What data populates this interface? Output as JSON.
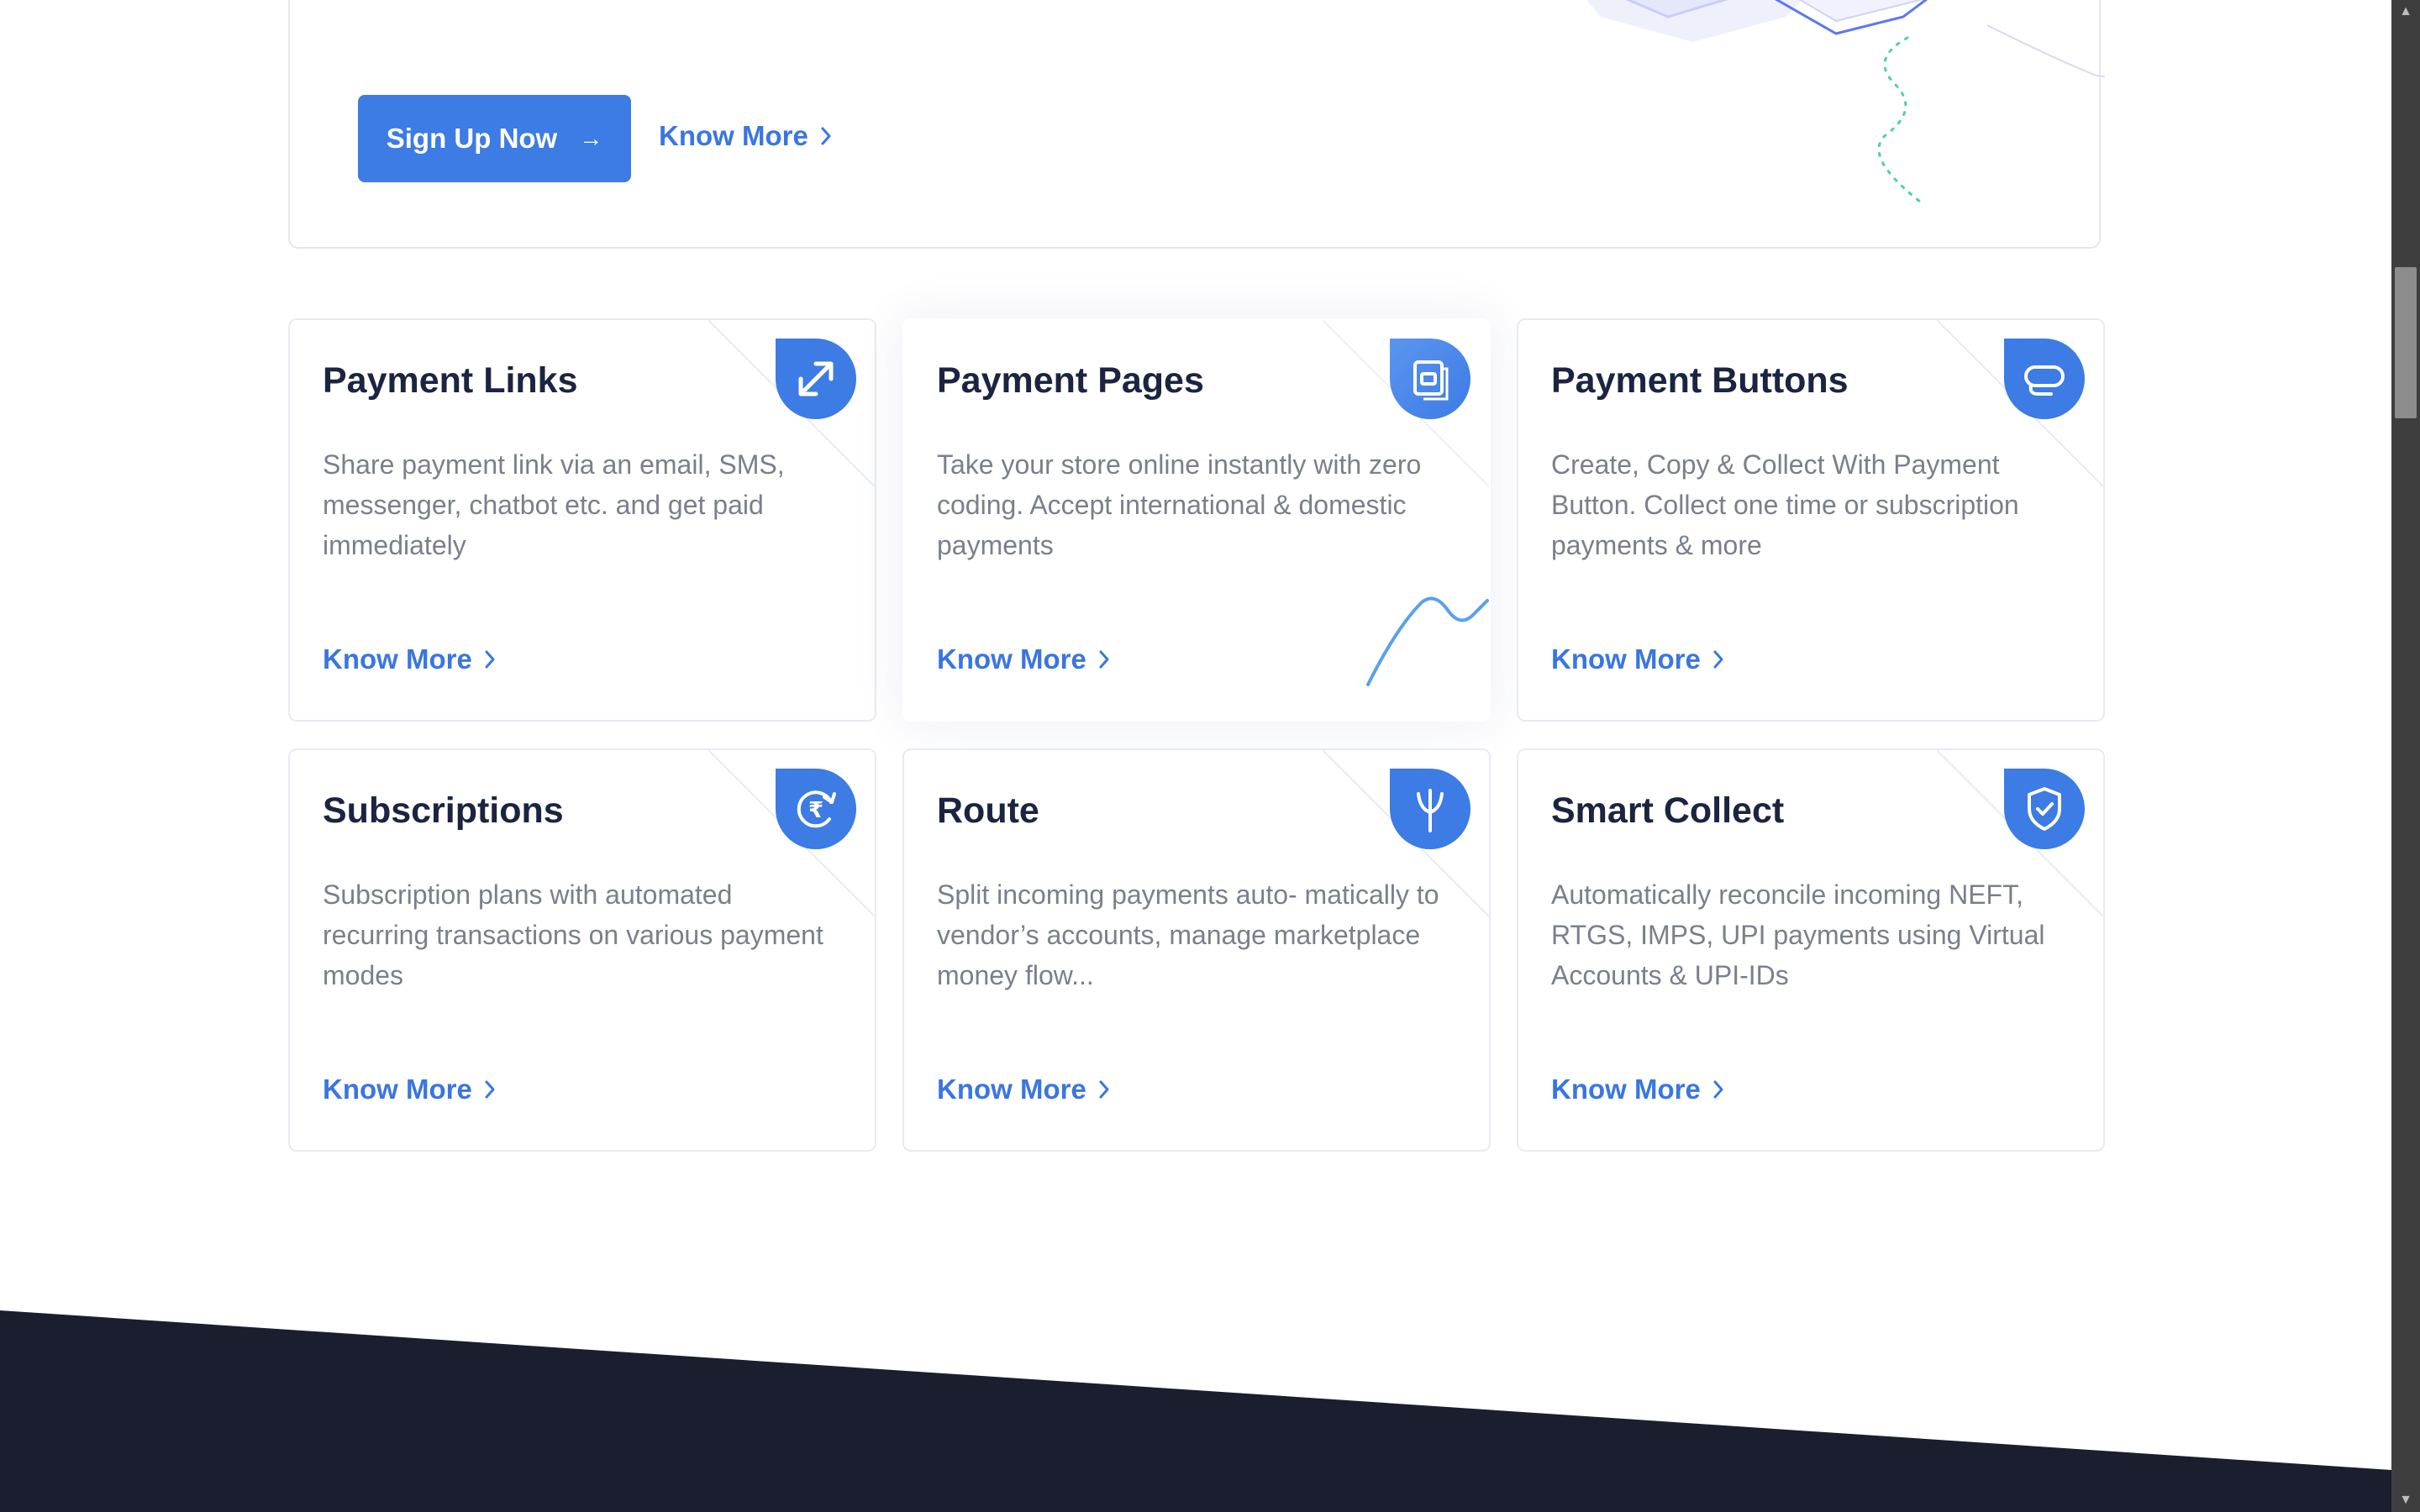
{
  "hero": {
    "signup_label": "Sign Up Now",
    "know_more_label": "Know More"
  },
  "cards": [
    {
      "title": "Payment Links",
      "description": "Share payment link via an email, SMS, messenger, chatbot etc. and get paid immediately",
      "link": "Know More",
      "icon": "swap-arrows-icon"
    },
    {
      "title": "Payment Pages",
      "description": "Take your store online instantly with zero coding. Accept international & domestic payments",
      "link": "Know More",
      "icon": "page-icon"
    },
    {
      "title": "Payment Buttons",
      "description": "Create, Copy & Collect With Payment Button. Collect one time or subscription payments & more",
      "link": "Know More",
      "icon": "button-icon"
    },
    {
      "title": "Subscriptions",
      "description": "Subscription plans with automated recurring transactions on various payment modes",
      "link": "Know More",
      "icon": "rupee-refresh-icon"
    },
    {
      "title": "Route",
      "description": "Split incoming payments auto- matically to vendor’s accounts, manage marketplace money flow...",
      "link": "Know More",
      "icon": "split-route-icon"
    },
    {
      "title": "Smart Collect",
      "description": "Automatically reconcile incoming NEFT, RTGS, IMPS, UPI payments using Virtual Accounts & UPI-IDs",
      "link": "Know More",
      "icon": "shield-check-icon"
    }
  ],
  "colors": {
    "accent": "#3d7be5",
    "link": "#3a76e0",
    "title": "#1b2440",
    "body_text": "#7a7f8c",
    "footer": "#1b1e2e"
  }
}
